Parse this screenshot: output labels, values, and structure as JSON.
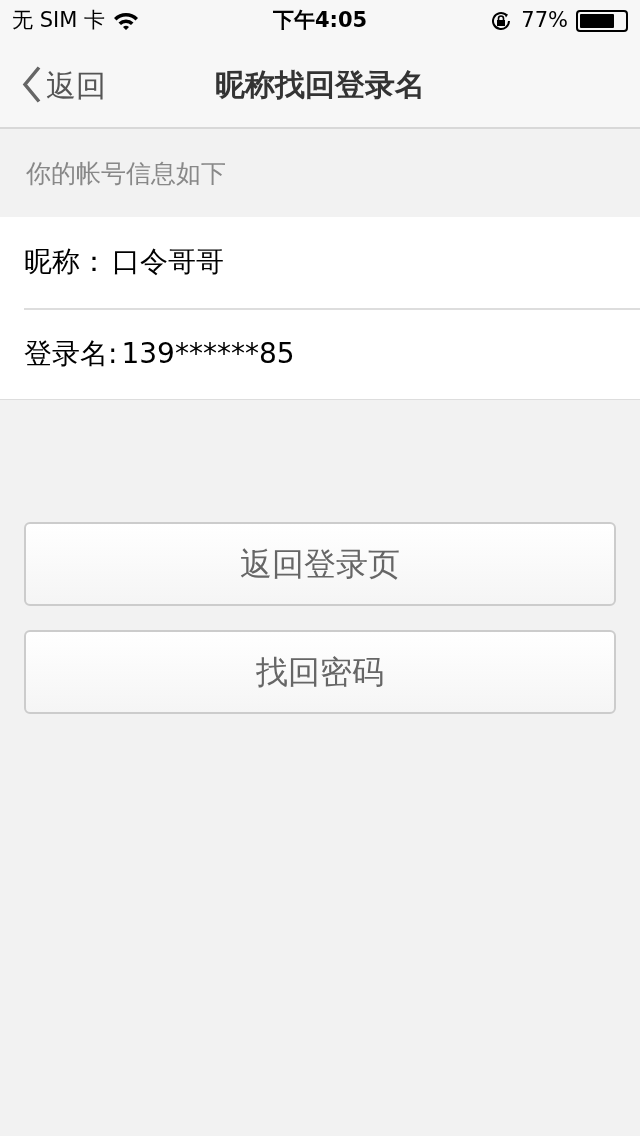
{
  "status_bar": {
    "carrier": "无 SIM 卡",
    "time": "下午4:05",
    "battery": "77%"
  },
  "nav_bar": {
    "back": "返回",
    "title": "昵称找回登录名"
  },
  "section_header": "你的帐号信息如下",
  "info_rows": [
    {
      "label": "昵称：",
      "value": "口令哥哥"
    },
    {
      "label": "登录名:",
      "value": "139******85"
    }
  ],
  "buttons": [
    "返回登录页",
    "找回密码"
  ]
}
